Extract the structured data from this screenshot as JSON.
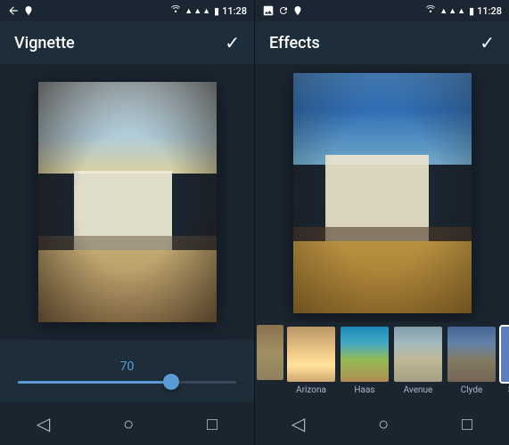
{
  "left": {
    "status": {
      "time": "11:28",
      "wifi_icon": "▼",
      "signal_icon": "▲▲▲",
      "battery_icon": "▮"
    },
    "title": "Vignette",
    "checkmark": "✓",
    "slider": {
      "value": "70",
      "fill_percent": 70
    }
  },
  "right": {
    "status": {
      "time": "11:28"
    },
    "title": "Effects",
    "checkmark": "✓",
    "filmstrip": {
      "items": [
        {
          "id": "none",
          "label": ""
        },
        {
          "id": "arizona",
          "label": "Arizona"
        },
        {
          "id": "haas",
          "label": "Haas"
        },
        {
          "id": "avenue",
          "label": "Avenue"
        },
        {
          "id": "clyde",
          "label": "Clyde"
        },
        {
          "id": "supplies",
          "label": "Supplies",
          "active": true
        }
      ]
    }
  },
  "nav": {
    "back_icon": "◁",
    "home_icon": "○",
    "recent_icon": "□"
  }
}
